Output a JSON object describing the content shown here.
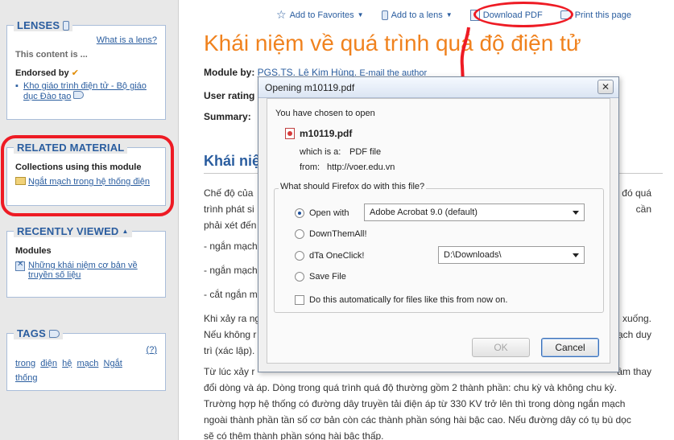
{
  "sidebar": {
    "lenses": {
      "title": "LENSES",
      "what_link": "What is a lens?",
      "content_label": "This content is ...",
      "endorsed_label": "Endorsed by",
      "endorse_link_line1": "Kho giáo trình điện tử - Bộ giáo",
      "endorse_link_line2": "dục Đào tạo"
    },
    "related": {
      "title": "RELATED MATERIAL",
      "collections_label": "Collections using this module",
      "collection_link": "Ngắt mạch trong hệ thống điện"
    },
    "recently": {
      "title": "RECENTLY VIEWED",
      "modules_label": "Modules",
      "module_link_line1": "Những khái niệm cơ bản về",
      "module_link_line2": "truyền số liệu"
    },
    "tags": {
      "title": "TAGS",
      "help": "(?)",
      "items": [
        "trong",
        "điện",
        "hệ",
        "mạch",
        "Ngắt",
        "thống"
      ]
    }
  },
  "toolbar": {
    "favorites": "Add to Favorites",
    "lens": "Add to a lens",
    "pdf": "Download PDF",
    "print": "Print this page"
  },
  "content": {
    "title": "Khái niệm về quá trình quá độ điện tử",
    "module_label": "Module by:",
    "author": "PGS.TS. Lê Kim Hùng.",
    "email": "E-mail the author",
    "rating_label": "User rating",
    "summary_label": "Summary:",
    "section_heading": "Khái niệ",
    "p1_l1": "Chế độ của",
    "p1_l1_right": "đó quá",
    "p1_l2": "trình phát si",
    "p1_l2_right": "cần",
    "p1_l3": "phải xét đến",
    "b1": "- ngắn mạch",
    "b2": "- ngắn mạch",
    "b3": "- cắt ngắn m",
    "p2_l1": "Khi xảy ra ng",
    "p2_l1_right": "xuống.",
    "p2_l2": "Nếu không r",
    "p2_l2_right": "mạch duy",
    "p2_l3": "trì (xác lập).",
    "p3_l1": "Từ lúc xảy r",
    "p3_l1_right": "ầm thay",
    "p3_l2": "đổi dòng và áp. Dòng trong quá trình quá độ thường gồm 2 thành phần: chu kỳ và không chu kỳ.",
    "p3_l3": "Trường hợp hệ thống có đường dây truyền tải điện áp từ 330 KV trở lên thì trong dòng ngắn mạch",
    "p3_l4": "ngoài thành phần tần số cơ bản còn các thành phần sóng hài bậc cao. Nếu đường dây có tụ bù dọc",
    "p3_l5": "sẽ có thêm thành phần sóng hài bậc thấp."
  },
  "dialog": {
    "title": "Opening m10119.pdf",
    "close": "✕",
    "intro": "You have chosen to open",
    "filename": "m10119.pdf",
    "which_label": "which is a:",
    "which_value": "PDF file",
    "from_label": "from:",
    "from_value": "http://voer.edu.vn",
    "question": "What should Firefox do with this file?",
    "open_with": "Open with",
    "open_with_app": "Adobe Acrobat 9.0 (default)",
    "downthemall": "DownThemAll!",
    "dta": "dTa OneClick!",
    "dta_path": "D:\\Downloads\\",
    "save_file": "Save File",
    "auto_label": "Do this automatically for files like this from now on.",
    "ok": "OK",
    "cancel": "Cancel"
  },
  "colors": {
    "accent": "#2a5d9f",
    "title_orange": "#f0821e",
    "annotation_red": "#ee1b24"
  }
}
